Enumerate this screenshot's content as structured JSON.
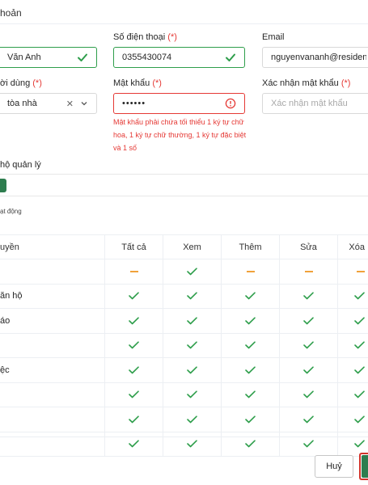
{
  "header": {
    "title": "hoản"
  },
  "form": {
    "name": {
      "value": "Văn Anh"
    },
    "phone": {
      "label": "Số điện thoại",
      "required_mark": "(*)",
      "value": "0355430074"
    },
    "email": {
      "label": "Email",
      "value": "nguyenvananh@resident.v"
    },
    "user_type": {
      "label": "ời dùng",
      "required_mark": "(*)",
      "value": "tòa nhà"
    },
    "password": {
      "label": "Mật khẩu",
      "required_mark": "(*)",
      "value": "••••••",
      "error": "Mật khẩu phải chứa tối thiểu 1 ký tự chữ hoa, 1 ký tự chữ thường, 1 ký tự đặc biệt và 1 số"
    },
    "confirm_password": {
      "label": "Xác nhận mật khẩu",
      "required_mark": "(*)",
      "placeholder": "Xác nhận mật khẩu"
    }
  },
  "apartments_section": {
    "label": "hộ quản lý"
  },
  "status": {
    "label": "ạt động"
  },
  "permissions": {
    "headers": [
      "uyền",
      "Tất cả",
      "Xem",
      "Thêm",
      "Sửa",
      "Xóa"
    ],
    "rows": [
      {
        "name": "",
        "cells": [
          "dash",
          "check",
          "dash",
          "dash",
          "dash"
        ]
      },
      {
        "name": "ăn hộ",
        "cells": [
          "check",
          "check",
          "check",
          "check",
          "check"
        ]
      },
      {
        "name": "áo",
        "cells": [
          "check",
          "check",
          "check",
          "check",
          "check"
        ]
      },
      {
        "name": "",
        "cells": [
          "check",
          "check",
          "check",
          "check",
          "check"
        ]
      },
      {
        "name": "ệc",
        "cells": [
          "check",
          "check",
          "check",
          "check",
          "check"
        ]
      },
      {
        "name": "",
        "cells": [
          "check",
          "check",
          "check",
          "check",
          "check"
        ]
      },
      {
        "name": "",
        "cells": [
          "check",
          "check",
          "check",
          "check",
          "check"
        ]
      },
      {
        "name": "",
        "cells": [
          "check",
          "check",
          "check",
          "check",
          "check"
        ]
      }
    ]
  },
  "footer": {
    "cancel_label": "Huỷ"
  },
  "colors": {
    "accent": "#2e7d4f",
    "success": "#2e9e4b",
    "error": "#e53935",
    "partial": "#f0a23a"
  }
}
